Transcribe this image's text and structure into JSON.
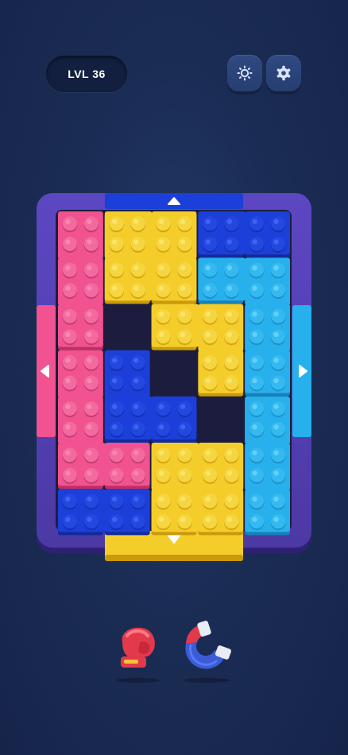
{
  "header": {
    "level_label": "LVL 36",
    "theme_button_icon": "sun-icon",
    "settings_button_icon": "gear-icon"
  },
  "colors": {
    "pink": "#f0538f",
    "yellow": "#f4cd2a",
    "blue": "#1c3fd9",
    "cyan": "#27b0ec",
    "frame": "#5540b4",
    "board_bg": "#1c1d3e"
  },
  "board": {
    "columns": 5,
    "rows": 7,
    "blocks": [
      {
        "name": "pink-block-top",
        "color": "pink",
        "cells": [
          [
            0,
            0
          ],
          [
            0,
            1
          ],
          [
            0,
            2
          ]
        ]
      },
      {
        "name": "pink-block-bottom",
        "color": "pink",
        "cells": [
          [
            0,
            3
          ],
          [
            0,
            4
          ],
          [
            0,
            5
          ],
          [
            1,
            5
          ]
        ]
      },
      {
        "name": "yellow-block-top",
        "color": "yellow",
        "cells": [
          [
            1,
            0
          ],
          [
            2,
            0
          ],
          [
            1,
            1
          ],
          [
            2,
            1
          ]
        ]
      },
      {
        "name": "yellow-block-middle",
        "color": "yellow",
        "cells": [
          [
            2,
            2
          ],
          [
            3,
            2
          ],
          [
            3,
            3
          ]
        ]
      },
      {
        "name": "yellow-block-bottom",
        "color": "yellow",
        "cells": [
          [
            2,
            5
          ],
          [
            3,
            5
          ],
          [
            2,
            6
          ],
          [
            3,
            6
          ]
        ]
      },
      {
        "name": "blue-block-top",
        "color": "blue",
        "cells": [
          [
            3,
            0
          ],
          [
            4,
            0
          ]
        ]
      },
      {
        "name": "blue-block-middle",
        "color": "blue",
        "cells": [
          [
            1,
            3
          ],
          [
            1,
            4
          ],
          [
            2,
            4
          ]
        ]
      },
      {
        "name": "blue-block-bottom",
        "color": "blue",
        "cells": [
          [
            0,
            6
          ],
          [
            1,
            6
          ]
        ]
      },
      {
        "name": "cyan-block-right",
        "color": "cyan",
        "cells": [
          [
            3,
            1
          ],
          [
            4,
            1
          ],
          [
            4,
            2
          ],
          [
            4,
            3
          ]
        ]
      },
      {
        "name": "cyan-block-bottom-right",
        "color": "cyan",
        "cells": [
          [
            4,
            4
          ],
          [
            4,
            5
          ],
          [
            4,
            6
          ]
        ]
      }
    ],
    "gates": [
      {
        "name": "gate-top-blue",
        "color": "blue",
        "side": "top",
        "direction": "up"
      },
      {
        "name": "gate-bottom-yellow",
        "color": "yellow",
        "side": "bottom",
        "direction": "down"
      },
      {
        "name": "gate-left-pink",
        "color": "pink",
        "side": "left",
        "direction": "left"
      },
      {
        "name": "gate-right-cyan",
        "color": "cyan",
        "side": "right",
        "direction": "right"
      }
    ]
  },
  "boosters": [
    {
      "name": "boxing-glove-booster",
      "icon": "boxing-glove-icon"
    },
    {
      "name": "magnet-booster",
      "icon": "magnet-icon"
    }
  ]
}
